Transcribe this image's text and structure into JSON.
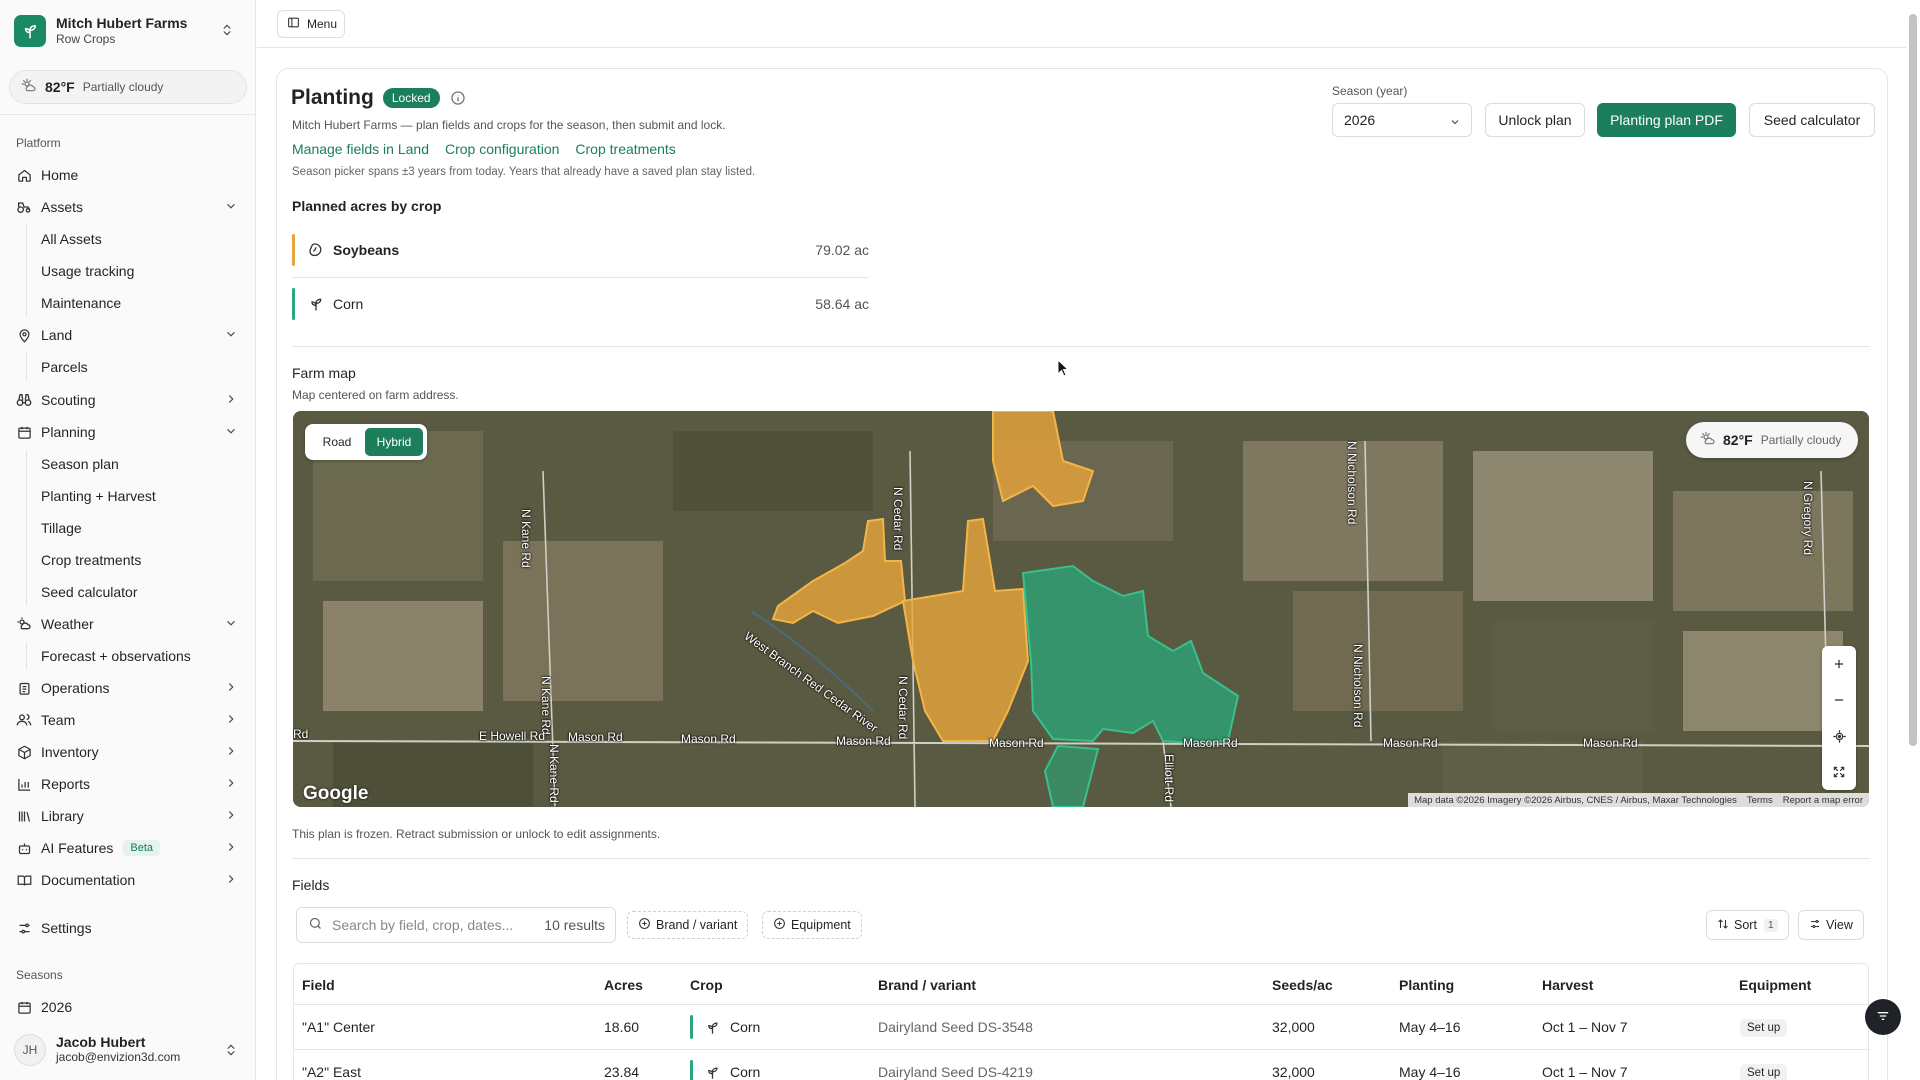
{
  "org": {
    "name": "Mitch Hubert Farms",
    "subtitle": "Row Crops"
  },
  "weather": {
    "temp": "82°F",
    "condition": "Partially cloudy"
  },
  "sidebar": {
    "platform_label": "Platform",
    "items": [
      {
        "label": "Home"
      },
      {
        "label": "Assets",
        "children": [
          "All Assets",
          "Usage tracking",
          "Maintenance"
        ]
      },
      {
        "label": "Land",
        "children": [
          "Parcels"
        ]
      },
      {
        "label": "Scouting"
      },
      {
        "label": "Planning",
        "children": [
          "Season plan",
          "Planting + Harvest",
          "Tillage",
          "Crop treatments",
          "Seed calculator"
        ]
      },
      {
        "label": "Weather",
        "children": [
          "Forecast + observations"
        ]
      },
      {
        "label": "Operations"
      },
      {
        "label": "Team"
      },
      {
        "label": "Inventory"
      },
      {
        "label": "Reports"
      },
      {
        "label": "Library"
      },
      {
        "label": "AI Features",
        "badge": "Beta"
      },
      {
        "label": "Documentation"
      }
    ],
    "settings_label": "Settings",
    "seasons_label": "Seasons",
    "season_item": "2026"
  },
  "user": {
    "initials": "JH",
    "name": "Jacob Hubert",
    "email": "jacob@envizion3d.com"
  },
  "topbar": {
    "menu_label": "Menu"
  },
  "page": {
    "title": "Planting",
    "status_badge": "Locked",
    "subtitle": "Mitch Hubert Farms — plan fields and crops for the season, then submit and lock.",
    "links": [
      "Manage fields in Land",
      "Crop configuration",
      "Crop treatments"
    ],
    "hint": "Season picker spans ±3 years from today. Years that already have a saved plan stay listed.",
    "season_label": "Season (year)",
    "season_value": "2026",
    "buttons": {
      "unlock": "Unlock plan",
      "pdf": "Planting plan PDF",
      "seed": "Seed calculator"
    }
  },
  "planned": {
    "heading": "Planned acres by crop",
    "crops": [
      {
        "name": "Soybeans",
        "acres": "79.02 ac",
        "color": "#e8a53b"
      },
      {
        "name": "Corn",
        "acres": "58.64 ac",
        "color": "#2aa87a"
      }
    ]
  },
  "farm_map": {
    "heading": "Farm map",
    "subtitle": "Map centered on farm address.",
    "toggle": {
      "road": "Road",
      "hybrid": "Hybrid"
    },
    "weather": {
      "temp": "82°F",
      "condition": "Partially cloudy"
    },
    "roads": [
      "N Kane Rd",
      "N Cedar Rd",
      "N Nicholson Rd",
      "N Gregory Rd",
      "West Branch Red Cedar River",
      "N Kane Rd",
      "N Cedar Rd",
      "N Nicholson Rd",
      "Rd",
      "E Howell Rd",
      "Mason Rd",
      "Mason Rd",
      "Mason Rd",
      "Mason Rd",
      "Mason Rd",
      "Mason Rd",
      "Mason Rd",
      "N Kane Rd S",
      "Elliott Rd"
    ],
    "google": "Google",
    "attribution": [
      "Map data ©2026 Imagery ©2026 Airbus, CNES / Airbus, Maxar Technologies",
      "Terms",
      "Report a map error"
    ],
    "field_colors": {
      "soybeans": "#e8a53b",
      "corn": "#2aa87a"
    }
  },
  "frozen_note": "This plan is frozen. Retract submission or unlock to edit assignments.",
  "fields": {
    "heading": "Fields",
    "search_placeholder": "Search by field, crop, dates...",
    "result_count": "10 results",
    "filters": [
      "Brand / variant",
      "Equipment"
    ],
    "sort_label": "Sort",
    "sort_count": "1",
    "view_label": "View",
    "columns": [
      "Field",
      "Acres",
      "Crop",
      "Brand / variant",
      "Seeds/ac",
      "Planting",
      "Harvest",
      "Equipment"
    ],
    "rows": [
      {
        "field": "\"A1\" Center",
        "acres": "18.60",
        "crop": "Corn",
        "brand": "Dairyland Seed DS-3548",
        "seeds": "32,000",
        "planting": "May 4–16",
        "harvest": "Oct 1 – Nov 7",
        "equipment": "Set up"
      },
      {
        "field": "\"A2\" East",
        "acres": "23.84",
        "crop": "Corn",
        "brand": "Dairyland Seed DS-4219",
        "seeds": "32,000",
        "planting": "May 4–16",
        "harvest": "Oct 1 – Nov 7",
        "equipment": "Set up"
      }
    ]
  }
}
